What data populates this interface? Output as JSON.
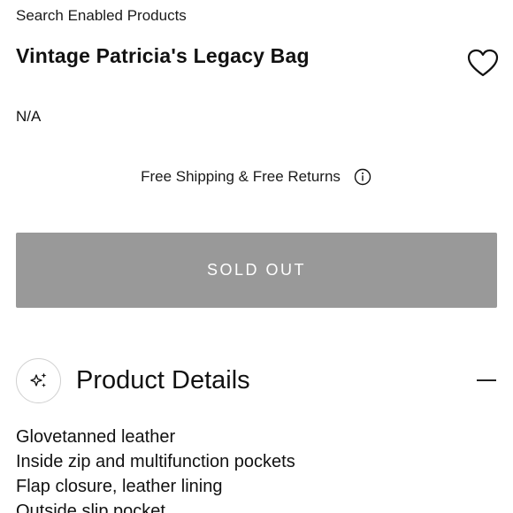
{
  "breadcrumb": "Search Enabled Products",
  "product": {
    "title": "Vintage Patricia's Legacy Bag",
    "price": "N/A"
  },
  "shipping": {
    "text": "Free Shipping & Free Returns"
  },
  "actions": {
    "sold_out_label": "SOLD OUT"
  },
  "details": {
    "title": "Product Details",
    "items": [
      "Glovetanned leather",
      "Inside zip and multifunction pockets",
      "Flap closure, leather lining",
      "Outside slip pocket"
    ]
  },
  "icons": {
    "wishlist": "heart-icon",
    "info": "info-icon",
    "details": "sparkle-icon",
    "collapse": "minus-icon"
  },
  "colors": {
    "button_bg": "#999999",
    "button_text": "#ffffff",
    "text": "#111111"
  }
}
